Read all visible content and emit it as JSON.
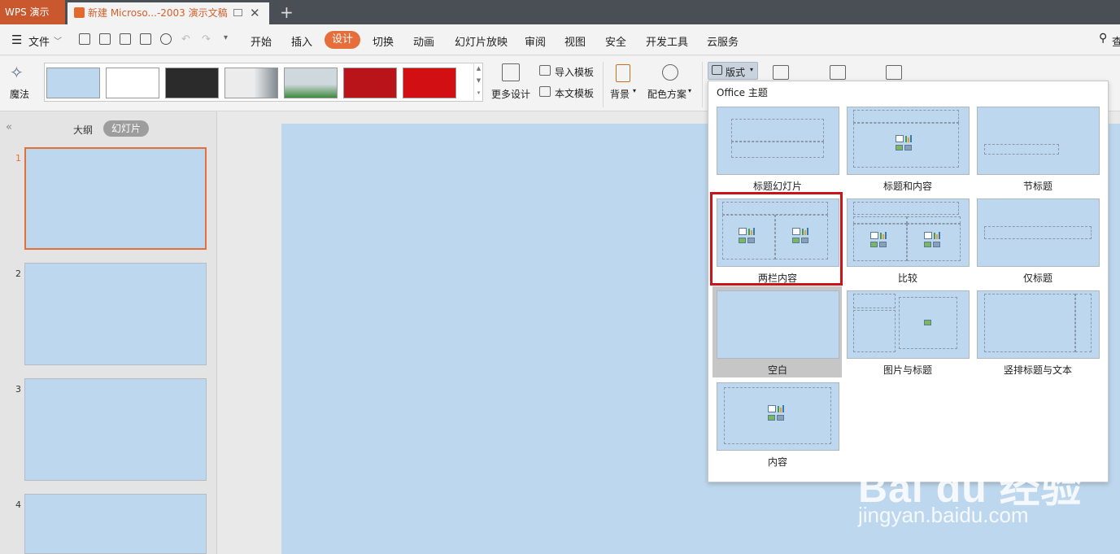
{
  "titlebar": {
    "app_tab": "WPS 演示",
    "doc_tab": "新建 Microso...-2003 演示文稿",
    "close": "✕",
    "new_tab": "+"
  },
  "menubar": {
    "file": "文件",
    "items": [
      "开始",
      "插入",
      "设计",
      "切换",
      "动画",
      "幻灯片放映",
      "审阅",
      "视图",
      "安全",
      "开发工具",
      "云服务"
    ],
    "search_partial": "查"
  },
  "ribbon": {
    "magic": "魔法",
    "more_design": "更多设计",
    "import_template": "导入模板",
    "this_template": "本文模板",
    "background": "背景",
    "color_scheme": "配色方案",
    "layout": "版式",
    "thumb_colors": [
      "#bdd7ee",
      "#ffffff",
      "#2b2b2b",
      "#e6e6e6",
      "#dfe6ea",
      "#b8141a",
      "#d21014"
    ]
  },
  "leftpanel": {
    "tab_outline": "大纲",
    "tab_slides": "幻灯片",
    "slide_numbers": [
      "1",
      "2",
      "3",
      "4"
    ]
  },
  "dropdown": {
    "title": "Office 主题",
    "layouts": [
      "标题幻灯片",
      "标题和内容",
      "节标题",
      "两栏内容",
      "比较",
      "仅标题",
      "空白",
      "图片与标题",
      "竖排标题与文本",
      "内容"
    ],
    "selected": "空白",
    "highlighted": "两栏内容"
  },
  "watermark": {
    "brand": "Bai du 经验",
    "url": "jingyan.baidu.com"
  }
}
